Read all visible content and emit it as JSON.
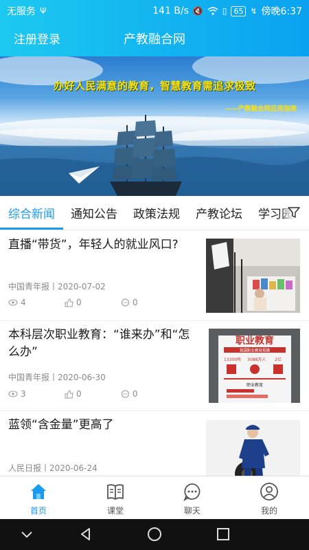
{
  "status_bar": {
    "carrier": "无服务",
    "speed": "141 B/s",
    "battery": "65",
    "time": "傍晚6:37"
  },
  "header": {
    "login": "注册登录",
    "title": "产教融合网"
  },
  "banner": {
    "slogan": "办好人民满意的教育，智慧教育需追求极致",
    "sub": "——产教融合网应用指南"
  },
  "tabs": [
    {
      "label": "综合新闻"
    },
    {
      "label": "通知公告"
    },
    {
      "label": "政策法规"
    },
    {
      "label": "产教论坛"
    },
    {
      "label": "学习园"
    }
  ],
  "news": [
    {
      "title": "直播“带货”，年轻人的就业风口?",
      "meta": "中国青年报丨2020-07-02",
      "views": "4",
      "likes": "0",
      "comments": "0"
    },
    {
      "title": "本科层次职业教育：“谁来办”和“怎么办”",
      "meta": "中国青年报丨2020-06-30",
      "views": "3",
      "likes": "0",
      "comments": "0"
    },
    {
      "title": "蓝领“含金量”更高了",
      "meta": "人民日报丨2020-06-24"
    }
  ],
  "thumb2": {
    "heading": "职业教育",
    "sub": "我国职业教育规模",
    "num1": "13300所",
    "num2": "3088万人",
    "num3": "2亿",
    "label": "职业教育"
  },
  "bottom_nav": [
    {
      "label": "首页",
      "icon": "home-icon"
    },
    {
      "label": "课堂",
      "icon": "book-icon"
    },
    {
      "label": "聊天",
      "icon": "chat-icon"
    },
    {
      "label": "我的",
      "icon": "profile-icon"
    }
  ],
  "colors": {
    "accent": "#1a9bf0",
    "header_start": "#1cc8f0",
    "header_end": "#0aa2f0"
  }
}
